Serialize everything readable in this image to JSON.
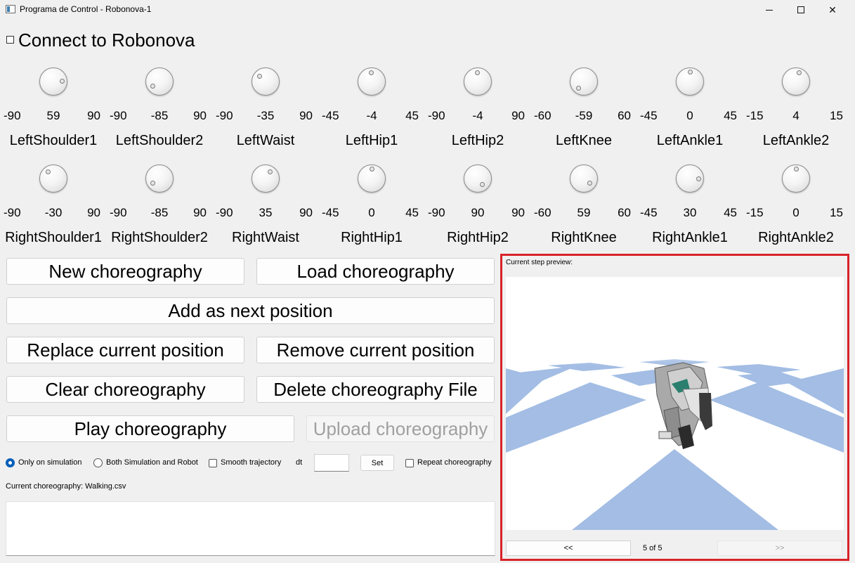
{
  "window": {
    "title": "Programa de Control - Robonova-1"
  },
  "connect": {
    "label": "Connect to Robonova",
    "checked": false
  },
  "joints_row1": [
    {
      "min": "-90",
      "value": "59",
      "max": "90",
      "name": "LeftShoulder1"
    },
    {
      "min": "-90",
      "value": "-85",
      "max": "90",
      "name": "LeftShoulder2"
    },
    {
      "min": "-90",
      "value": "-35",
      "max": "90",
      "name": "LeftWaist"
    },
    {
      "min": "-45",
      "value": "-4",
      "max": "45",
      "name": "LeftHip1"
    },
    {
      "min": "-90",
      "value": "-4",
      "max": "90",
      "name": "LeftHip2"
    },
    {
      "min": "-60",
      "value": "-59",
      "max": "60",
      "name": "LeftKnee"
    },
    {
      "min": "-45",
      "value": "0",
      "max": "45",
      "name": "LeftAnkle1"
    },
    {
      "min": "-15",
      "value": "4",
      "max": "15",
      "name": "LeftAnkle2"
    }
  ],
  "joints_row2": [
    {
      "min": "-90",
      "value": "-30",
      "max": "90",
      "name": "RightShoulder1"
    },
    {
      "min": "-90",
      "value": "-85",
      "max": "90",
      "name": "RightShoulder2"
    },
    {
      "min": "-90",
      "value": "35",
      "max": "90",
      "name": "RightWaist"
    },
    {
      "min": "-45",
      "value": "0",
      "max": "45",
      "name": "RightHip1"
    },
    {
      "min": "-90",
      "value": "90",
      "max": "90",
      "name": "RightHip2"
    },
    {
      "min": "-60",
      "value": "59",
      "max": "60",
      "name": "RightKnee"
    },
    {
      "min": "-45",
      "value": "30",
      "max": "45",
      "name": "RightAnkle1"
    },
    {
      "min": "-15",
      "value": "0",
      "max": "15",
      "name": "RightAnkle2"
    }
  ],
  "buttons": {
    "new": "New choreography",
    "load": "Load choreography",
    "add": "Add as next position",
    "replace": "Replace current position",
    "remove": "Remove current position",
    "clear": "Clear choreography",
    "delete": "Delete choreography File",
    "play": "Play choreography",
    "upload": "Upload choreography"
  },
  "options": {
    "only_sim": "Only on simulation",
    "both": "Both Simulation and Robot",
    "smooth": "Smooth trajectory",
    "dt_label": "dt",
    "dt_value": "",
    "set": "Set",
    "repeat": "Repeat choreography",
    "selected_mode": "only_sim"
  },
  "current_choreography": "Current choreography: Walking.csv",
  "preview": {
    "label": "Current step preview:",
    "prev": "<<",
    "next": ">>",
    "step": "5 of 5"
  },
  "colors": {
    "highlight_border": "#d8232a",
    "floor_tile": "#a3bde4",
    "radio_accent": "#005fb8"
  },
  "icons": {
    "minimize": "minimize-icon",
    "maximize": "maximize-icon",
    "close": "close-icon"
  }
}
